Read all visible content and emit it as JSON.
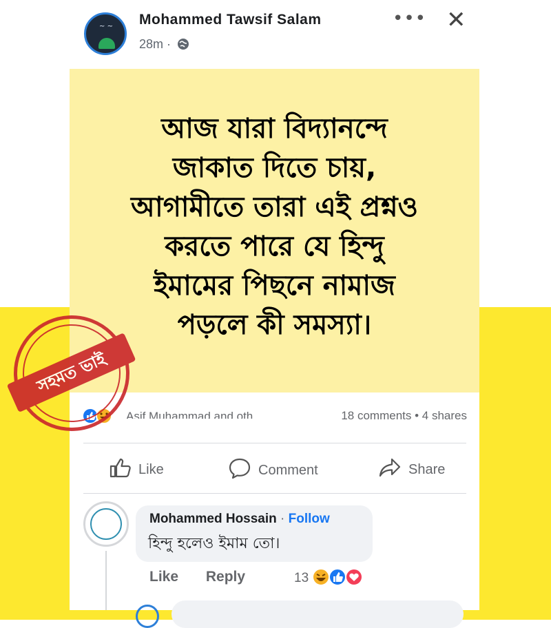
{
  "post": {
    "author": "Mohammed Tawsif Salam",
    "time": "28m ·",
    "text_lines": [
      "আজ যারা বিদ্যানন্দে",
      "জাকাত দিতে চায়,",
      "আগামীতে তারা এই প্রশ্নও",
      "করতে পারে যে হিন্দু",
      "ইমামের পিছনে নামাজ",
      "পড়লে কী সমস্যা।"
    ],
    "reactors": "Asif Muhammad and oth...",
    "stats": "18 comments • 4 shares",
    "actions": {
      "like": "Like",
      "comment": "Comment",
      "share": "Share"
    }
  },
  "comment": {
    "author": "Mohammed Hossain",
    "sep": " · ",
    "follow": "Follow",
    "text": "হিন্দু হলেও ইমাম তো।",
    "like": "Like",
    "reply": "Reply",
    "reaction_count": "13"
  },
  "stamp": {
    "label": "সহমত ভাই"
  },
  "colors": {
    "brand_blue": "#1877f2",
    "stamp_red": "#c9262b",
    "yellow": "#fde82f",
    "post_bg": "#fdf1a5"
  }
}
